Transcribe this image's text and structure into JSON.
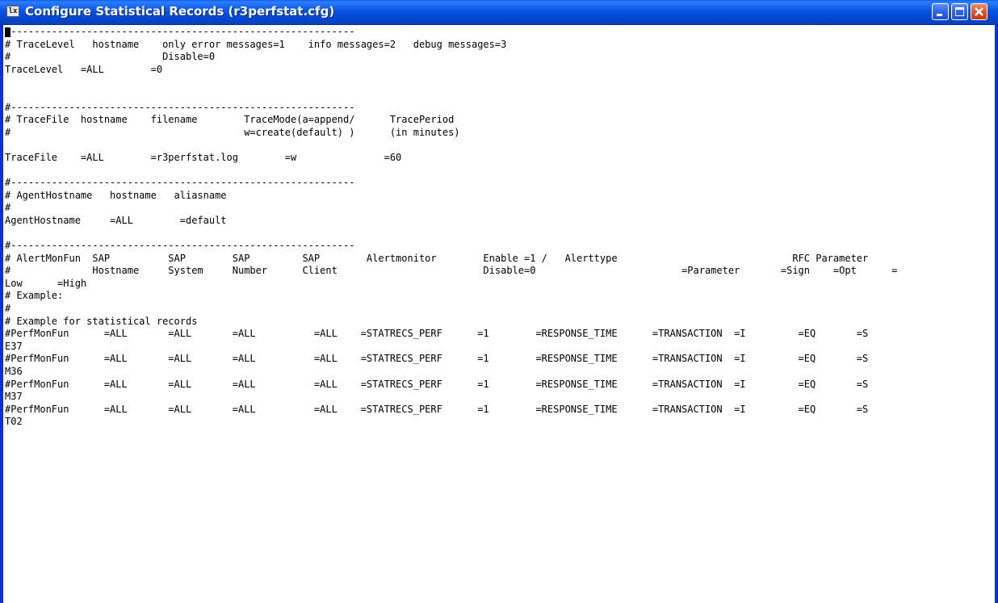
{
  "window": {
    "title": "Configure Statistical Records (r3perfstat.cfg)",
    "app_icon_text": "lx",
    "title_color": "#ffffff",
    "titlebar_color": "#0754e0",
    "close_button_color": "#e0532e"
  },
  "editor": {
    "filename": "r3perfstat.cfg",
    "lines": [
      "#-----------------------------------------------------------",
      "# TraceLevel   hostname    only error messages=1    info messages=2   debug messages=3",
      "#                          Disable=0",
      "TraceLevel   =ALL        =0",
      "",
      "",
      "#-----------------------------------------------------------",
      "# TraceFile  hostname    filename        TraceMode(a=append/      TracePeriod",
      "#                                        w=create(default) )      (in minutes)",
      "",
      "TraceFile    =ALL        =r3perfstat.log        =w               =60",
      "",
      "#-----------------------------------------------------------",
      "# AgentHostname   hostname   aliasname",
      "#",
      "AgentHostname     =ALL        =default",
      "",
      "#-----------------------------------------------------------",
      "# AlertMonFun  SAP          SAP        SAP         SAP        Alertmonitor        Enable =1 /   Alerttype                              RFC Parameter",
      "#              Hostname     System     Number      Client                         Disable=0                         =Parameter       =Sign    =Opt      =",
      "Low      =High",
      "# Example:",
      "#",
      "# Example for statistical records",
      "#PerfMonFun      =ALL       =ALL       =ALL          =ALL    =STATRECS_PERF      =1        =RESPONSE_TIME      =TRANSACTION  =I         =EQ       =S",
      "E37",
      "#PerfMonFun      =ALL       =ALL       =ALL          =ALL    =STATRECS_PERF      =1        =RESPONSE_TIME      =TRANSACTION  =I         =EQ       =S",
      "M36",
      "#PerfMonFun      =ALL       =ALL       =ALL          =ALL    =STATRECS_PERF      =1        =RESPONSE_TIME      =TRANSACTION  =I         =EQ       =S",
      "M37",
      "#PerfMonFun      =ALL       =ALL       =ALL          =ALL    =STATRECS_PERF      =1        =RESPONSE_TIME      =TRANSACTION  =I         =EQ       =S",
      "T02"
    ]
  },
  "icons": {
    "app": "application-window-icon",
    "minimize": "minimize-icon",
    "maximize": "maximize-icon",
    "close": "close-icon"
  }
}
